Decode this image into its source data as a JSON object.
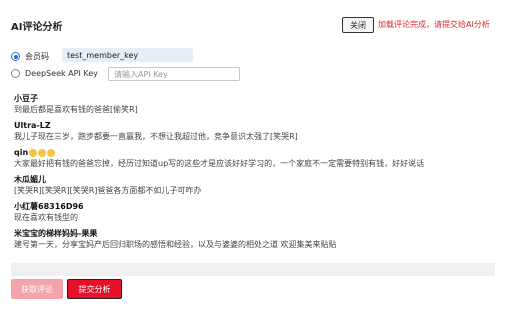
{
  "header": {
    "title": "AI评论分析",
    "close_label": "关闭",
    "status": "加载评论完成，请提交给AI分析"
  },
  "options": [
    {
      "label": "会员码",
      "value": "test_member_key",
      "checked": true
    },
    {
      "label": "DeepSeek API Key",
      "placeholder": "请输入API Key",
      "checked": false
    }
  ],
  "comments": [
    {
      "author": "小豆子",
      "text": "到最后都是喜欢有钱的爸爸[偷笑R]"
    },
    {
      "author": "Ultra-LZ",
      "text": "我儿子现在三岁，跑步都要一直赢我，不想让我超过他，竞争意识太强了[笑哭R]"
    },
    {
      "author": "qin",
      "emojis": 3,
      "text": "大家最好把有钱的爸爸忘掉，经历过知道up写的这些才是应该好好学习的，一个家庭不一定需要特别有钱，好好说话"
    },
    {
      "author": "木瓜媚儿",
      "text": "[笑哭R][笑哭R][笑哭R]爸爸各方面都不如儿子可咋办"
    },
    {
      "author": "小红薯68316D96",
      "text": "现在喜欢有钱型的"
    },
    {
      "author": "米宝宝的梯样妈妈-果果",
      "text": "建号第一天，分享宝妈产后回归职场的感悟和经验，以及与婆婆的相处之道 欢迎集美来贴贴"
    }
  ],
  "buttons": {
    "fetch_label": "获取评论",
    "submit_label": "提交分析"
  },
  "colors": {
    "accent": "#e6102b",
    "accent_disabled": "#f4a4a8",
    "status": "#e0282e"
  }
}
